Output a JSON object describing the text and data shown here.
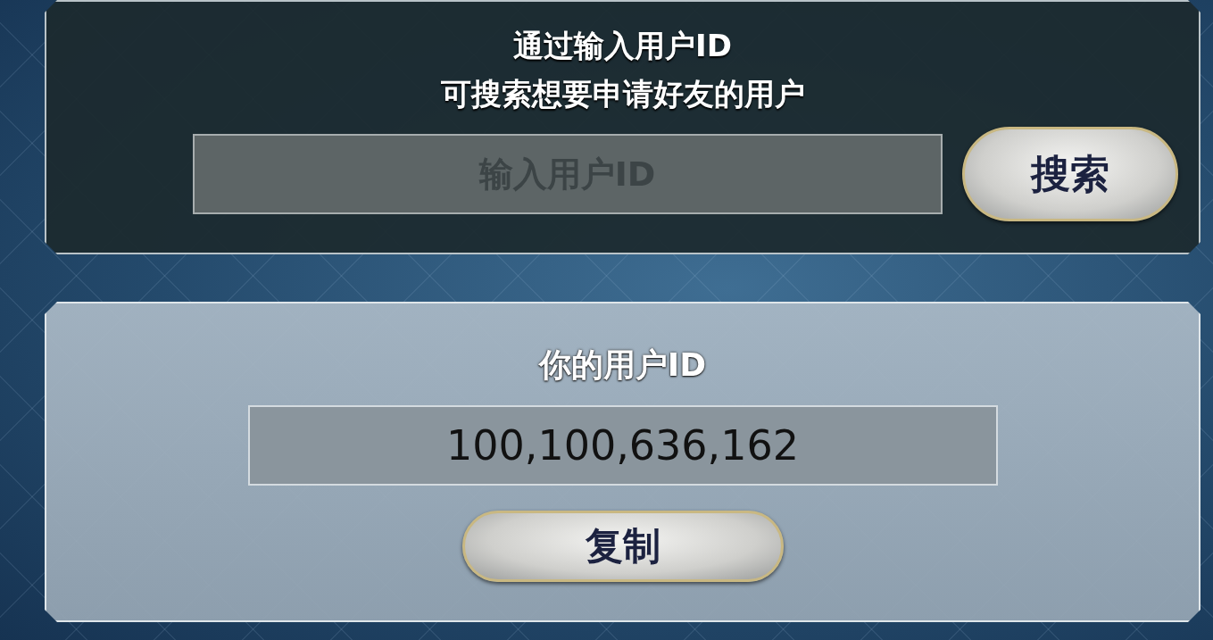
{
  "search_panel": {
    "title_lines": [
      "通过输入用户ID",
      "可搜索想要申请好友的用户"
    ],
    "search_field": {
      "placeholder": "输入用户ID"
    },
    "search_button": "搜索"
  },
  "id_panel": {
    "title": "你的用户ID",
    "user_id": "100,100,636,162",
    "copy_button": "复制"
  }
}
